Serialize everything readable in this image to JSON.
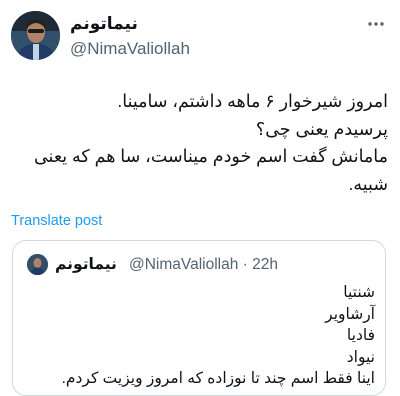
{
  "tweet": {
    "display_name": "نیماتونم",
    "handle": "@NimaValiollah",
    "more_icon": "more-dots-icon",
    "text": "امروز شیرخوار ۶ ماهه داشتم، سامینا.\nپرسیدم یعنی چی؟\nمامانش گفت اسم خودم میناست، سا هم که یعنی\nشبیه.",
    "translate_label": "Translate post"
  },
  "quote": {
    "display_name": "نیماتونم",
    "handle_time": "@NimaValiollah · 22h",
    "text": "شنتیا\nآرشاویر\nفادیا\nنیواد\nاینا فقط اسم چند تا نوزاده که امروز ویزیت کردم."
  },
  "colors": {
    "accent": "#1d9bf0",
    "secondary_text": "#536471",
    "border": "#cfd9de"
  }
}
